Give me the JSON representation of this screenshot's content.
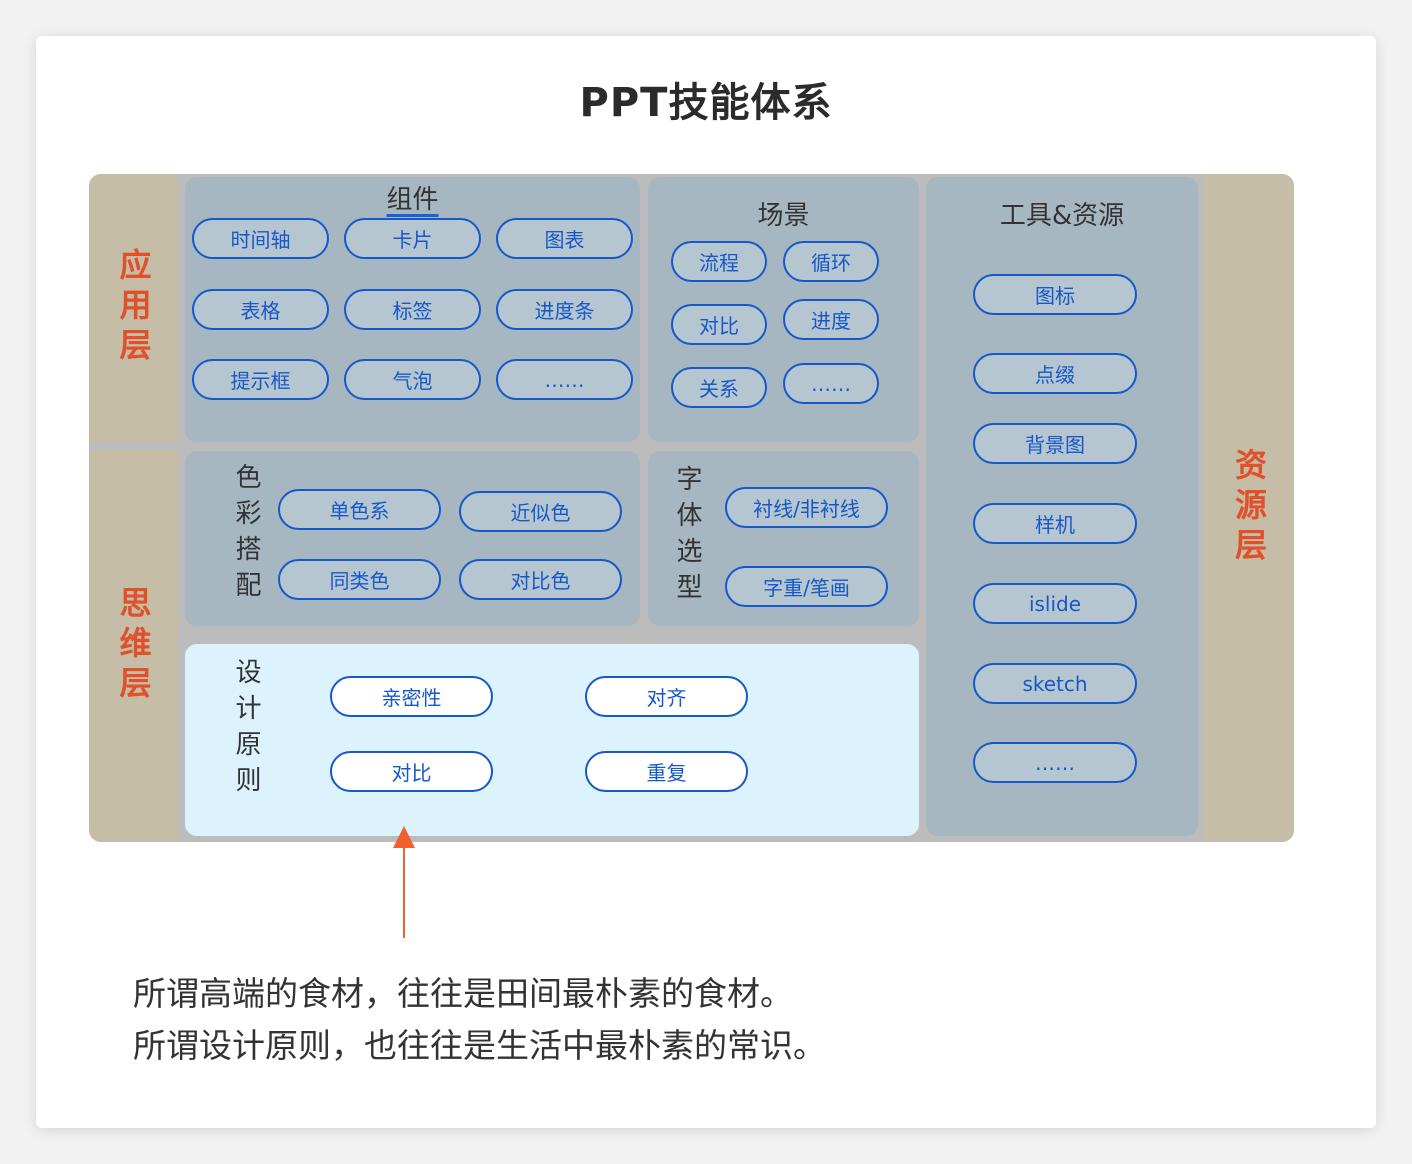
{
  "title": "PPT技能体系",
  "layers": {
    "application": "应用层",
    "thinking": "思维层",
    "resource": "资源层"
  },
  "components": {
    "title": "组件",
    "items": [
      "时间轴",
      "卡片",
      "图表",
      "表格",
      "标签",
      "进度条",
      "提示框",
      "气泡",
      "……"
    ]
  },
  "scenes": {
    "title": "场景",
    "items": [
      "流程",
      "循环",
      "对比",
      "进度",
      "关系",
      "……"
    ]
  },
  "tools": {
    "title": "工具&资源",
    "items": [
      "图标",
      "点缀",
      "背景图",
      "样机",
      "islide",
      "sketch",
      "……"
    ]
  },
  "color": {
    "label": "色彩搭配",
    "items": [
      "单色系",
      "近似色",
      "同类色",
      "对比色"
    ]
  },
  "font": {
    "label": "字体选型",
    "items": [
      "衬线/非衬线",
      "字重/笔画"
    ]
  },
  "design": {
    "label": "设计原则",
    "items": [
      "亲密性",
      "对齐",
      "对比",
      "重复"
    ]
  },
  "caption": {
    "line1": "所谓高端的食材，往往是田间最朴素的食材。",
    "line2": "所谓设计原则，也往往是生活中最朴素的常识。"
  },
  "colors": {
    "accent": "#1658c8",
    "layer_text": "#e0502a",
    "arrow": "#f06030"
  }
}
